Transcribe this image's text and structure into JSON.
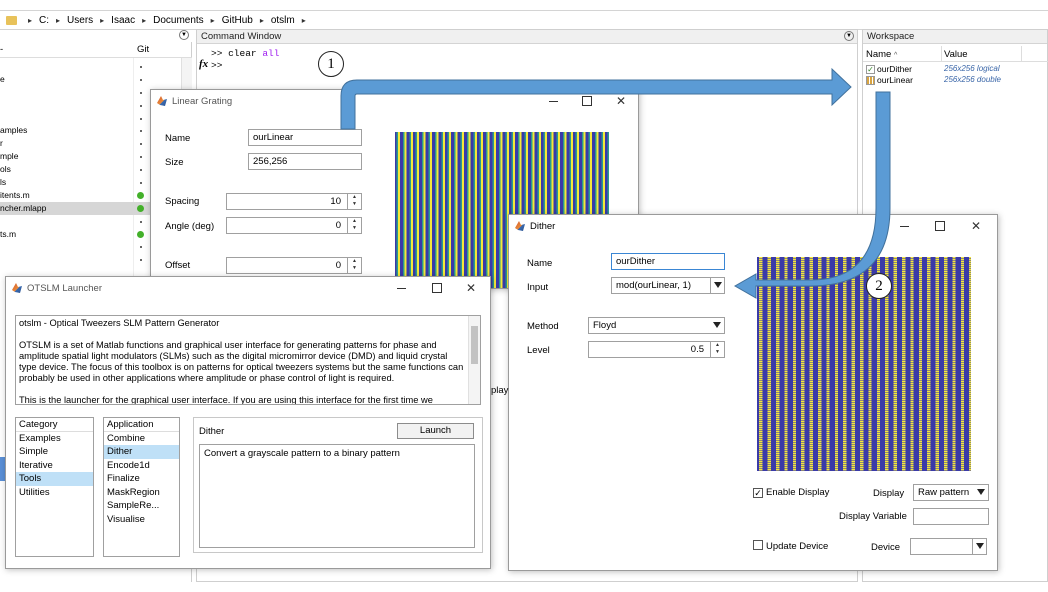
{
  "address": {
    "crumbs": [
      "C:",
      "Users",
      "Isaac",
      "Documents",
      "GitHub",
      "otslm"
    ]
  },
  "left_panel": {
    "git_label": "Git",
    "files": [
      {
        "name": "",
        "dot": "small"
      },
      {
        "name": "e",
        "dot": "small"
      },
      {
        "name": "",
        "dot": "small"
      },
      {
        "name": "",
        "dot": "small"
      },
      {
        "name": "",
        "dot": "small"
      },
      {
        "name": "amples",
        "dot": "small"
      },
      {
        "name": "r",
        "dot": "small"
      },
      {
        "name": "mple",
        "dot": "small"
      },
      {
        "name": "ols",
        "dot": "small"
      },
      {
        "name": "ls",
        "dot": "small"
      },
      {
        "name": "itents.m",
        "dot": "green"
      },
      {
        "name": "ncher.mlapp",
        "dot": "green"
      },
      {
        "name": "",
        "dot": "small"
      },
      {
        "name": "ts.m",
        "dot": "green"
      },
      {
        "name": "",
        "dot": "small"
      },
      {
        "name": "",
        "dot": "small"
      }
    ]
  },
  "command_window": {
    "title": "Command Window",
    "prompt1": ">>",
    "cmd_kw": "clear",
    "cmd_arg": "all",
    "prompt2": ">>",
    "fx": "fx"
  },
  "workspace": {
    "title": "Workspace",
    "col_name": "Name",
    "col_value": "Value",
    "vars": [
      {
        "name": "ourDither",
        "value": "256x256 logical"
      },
      {
        "name": "ourLinear",
        "value": "256x256 double"
      }
    ]
  },
  "linear_grating": {
    "title": "Linear Grating",
    "name_label": "Name",
    "name_value": "ourLinear",
    "size_label": "Size",
    "size_value": "256,256",
    "spacing_label": "Spacing",
    "spacing_value": "10",
    "angle_label": "Angle (deg)",
    "angle_value": "0",
    "offset_label": "Offset",
    "offset_value": "0",
    "display_partial": "play"
  },
  "launcher": {
    "title": "OTSLM Launcher",
    "desc_heading": "otslm - Optical Tweezers SLM Pattern Generator",
    "desc_p1": "OTSLM is a set of Matlab functions and graphical user interface for generating patterns for phase and amplitude spatial light modulators (SLMs) such as the digital micromirror device (DMD) and liquid crystal type device. The focus of this toolbox is on patterns for optical tweezers systems but the same functions can probably be used in other applications where amplitude or phase control of light is required.",
    "desc_p2": "This is the launcher for the graphical user interface.  If you are using this interface for the first time we suggest you take a look at the examples tab and run a couple of the example to see how the different user interface",
    "category_header": "Category",
    "categories": [
      "Examples",
      "Simple",
      "Iterative",
      "Tools",
      "Utilities"
    ],
    "category_selected": "Tools",
    "application_header": "Application",
    "applications": [
      "Combine",
      "Dither",
      "Encode1d",
      "Finalize",
      "MaskRegion",
      "SampleRe...",
      "Visualise"
    ],
    "application_selected": "Dither",
    "selected_app_title": "Dither",
    "launch_label": "Launch",
    "selected_app_desc": "Convert a grayscale pattern to a binary pattern"
  },
  "dither": {
    "title": "Dither",
    "name_label": "Name",
    "name_value": "ourDither",
    "input_label": "Input",
    "input_value": "mod(ourLinear, 1)",
    "method_label": "Method",
    "method_value": "Floyd",
    "level_label": "Level",
    "level_value": "0.5",
    "enable_display_label": "Enable Display",
    "enable_display_checked": true,
    "display_label": "Display",
    "display_value": "Raw pattern",
    "display_variable_label": "Display Variable",
    "display_variable_value": "",
    "update_device_label": "Update Device",
    "update_device_checked": false,
    "device_label": "Device",
    "device_value": ""
  },
  "annotations": {
    "step1": "1",
    "step2": "2"
  },
  "colors": {
    "accent_arrow": "#5b9bd5",
    "arrow_stroke": "#41719c",
    "pattern_blue": "#3a3aa8",
    "pattern_yellow": "#f5e83a",
    "pattern_teal": "#2a9b8f",
    "selection": "#bfe0f7",
    "git_green": "#43b02a"
  }
}
